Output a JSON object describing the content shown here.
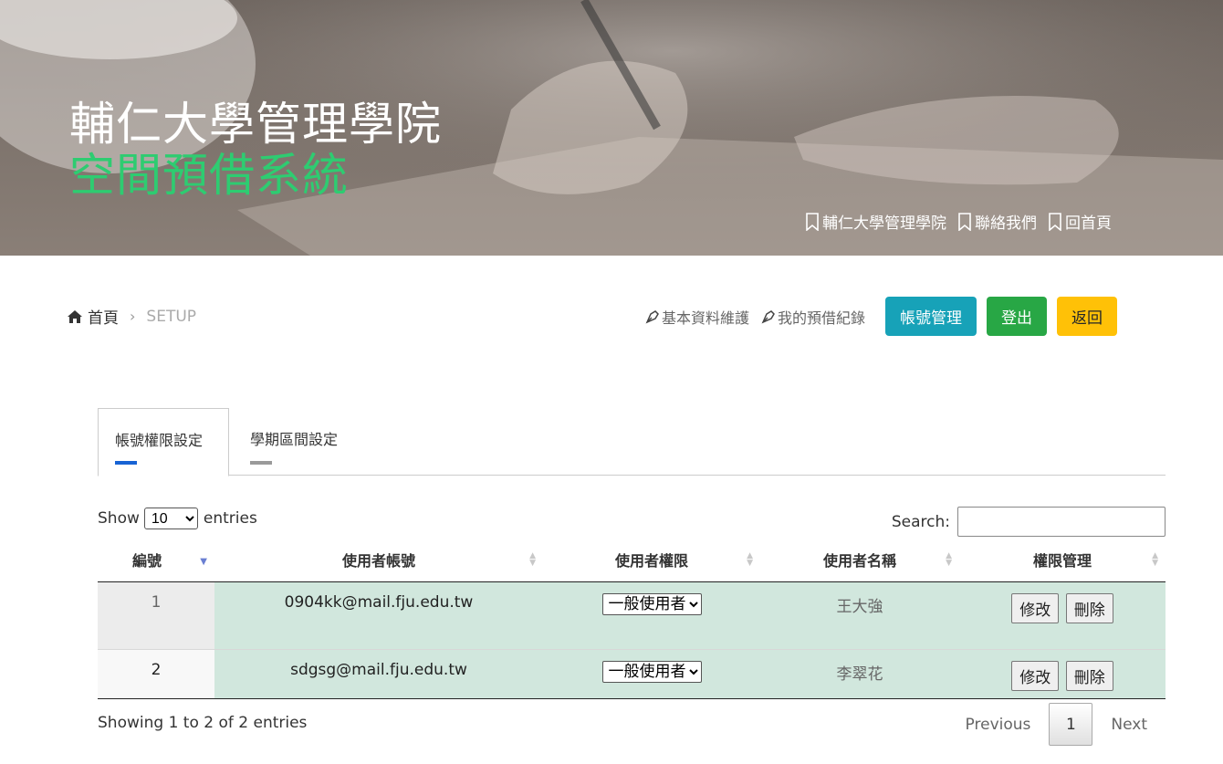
{
  "hero": {
    "title_line1": "輔仁大學管理學院",
    "title_line2": "空間預借系統",
    "links": [
      "輔仁大學管理學院",
      "聯絡我們",
      "回首頁"
    ]
  },
  "breadcrumb": {
    "home": "首頁",
    "current": "SETUP"
  },
  "actions": {
    "profile_link": "基本資料維護",
    "booking_link": "我的預借紀錄",
    "account_button": "帳號管理",
    "logout_button": "登出",
    "back_button": "返回"
  },
  "tabs": [
    "帳號權限設定",
    "學期區間設定"
  ],
  "datatable": {
    "show_label": "Show",
    "page_size": "10",
    "entries_label": "entries",
    "search_label": "Search:",
    "search_value": "",
    "columns": [
      "編號",
      "使用者帳號",
      "使用者權限",
      "使用者名稱",
      "權限管理"
    ],
    "rows": [
      {
        "id": "1",
        "account": "0904kk@mail.fju.edu.tw",
        "role": "一般使用者",
        "name": "王大強",
        "edit": "修改",
        "delete": "刪除"
      },
      {
        "id": "2",
        "account": "sdgsg@mail.fju.edu.tw",
        "role": "一般使用者",
        "name": "李翠花",
        "edit": "修改",
        "delete": "刪除"
      }
    ],
    "info": "Showing 1 to 2 of 2 entries",
    "pager": {
      "previous": "Previous",
      "current": "1",
      "next": "Next"
    }
  },
  "colors": {
    "accent_green": "#2ecc71",
    "info": "#17a2b8",
    "success": "#28a745",
    "warning": "#ffc107",
    "row_highlight": "#d1e7dd"
  }
}
